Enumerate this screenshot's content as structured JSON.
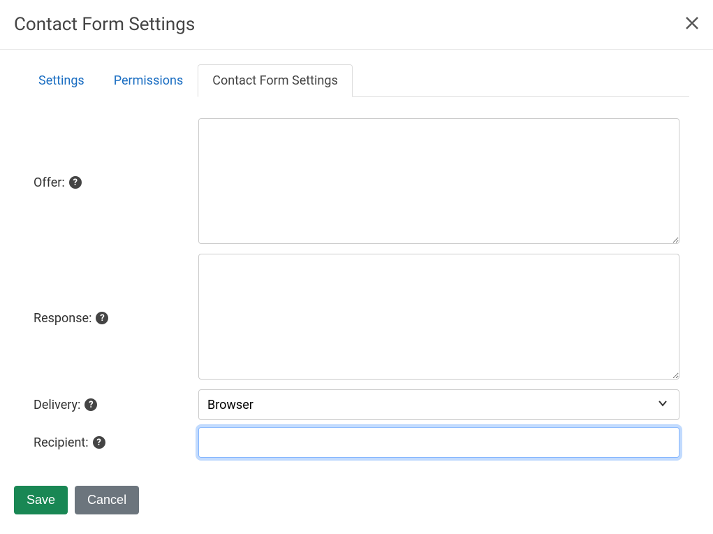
{
  "header": {
    "title": "Contact Form Settings"
  },
  "tabs": {
    "settings": "Settings",
    "permissions": "Permissions",
    "contact_form_settings": "Contact Form Settings"
  },
  "form": {
    "offer_label": "Offer:",
    "response_label": "Response:",
    "delivery_label": "Delivery:",
    "recipient_label": "Recipient:",
    "delivery_value": "Browser",
    "recipient_value": ""
  },
  "buttons": {
    "save": "Save",
    "cancel": "Cancel"
  }
}
